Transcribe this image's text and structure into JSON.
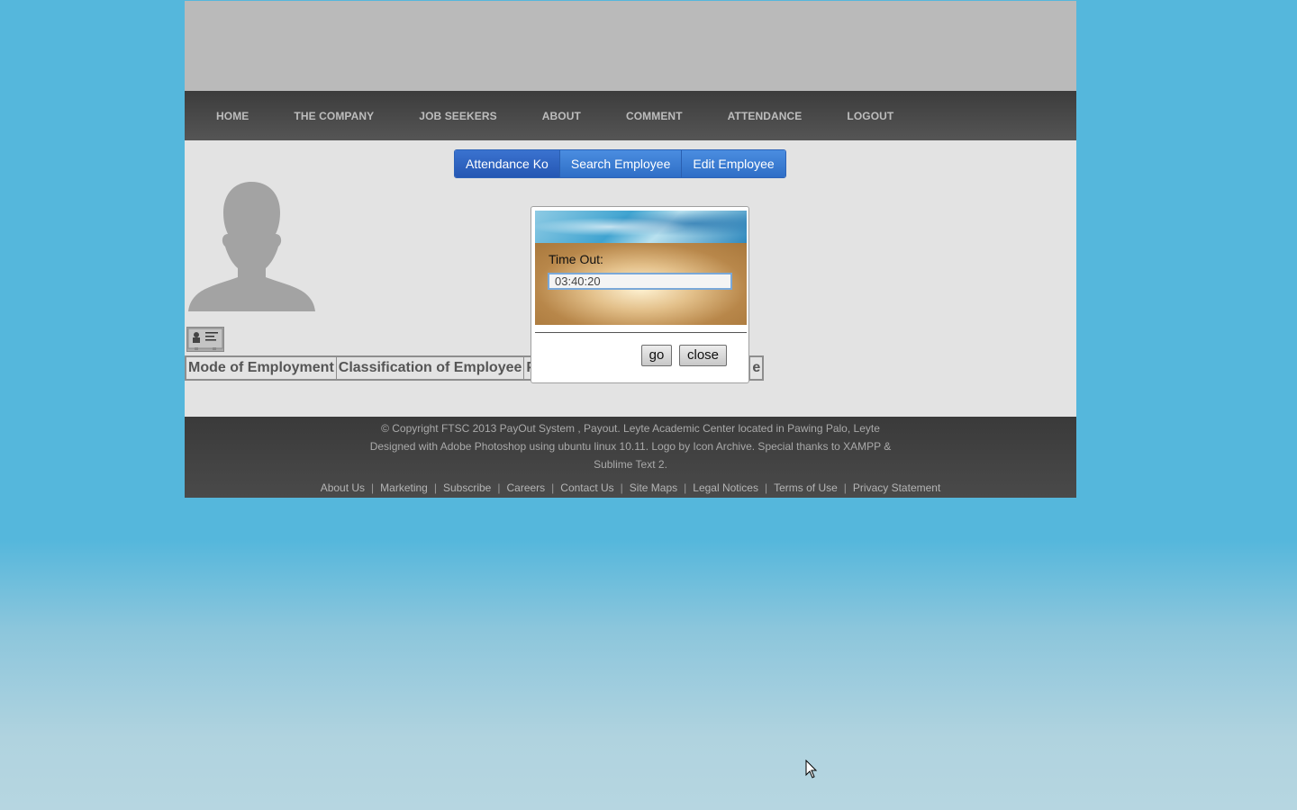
{
  "nav": {
    "items": [
      "HOME",
      "THE COMPANY",
      "JOB SEEKERS",
      "ABOUT",
      "COMMENT",
      "ATTENDANCE",
      "LOGOUT"
    ]
  },
  "subtabs": {
    "items": [
      "Attendance Ko",
      "Search Employee",
      "Edit Employee"
    ]
  },
  "table": {
    "headers": [
      "Mode of Employment",
      "Classification of Employee",
      "P",
      "e"
    ]
  },
  "modal": {
    "label": "Time Out:",
    "time_value": "03:40:20",
    "go_label": "go",
    "close_label": "close"
  },
  "footer": {
    "copyright": "© Copyright FTSC 2013 PayOut System , Payout. Leyte Academic Center located in Pawing Palo, Leyte",
    "designed_line1": "Designed with Adobe Photoshop using ubuntu linux 10.11. Logo by Icon Archive. Special thanks to XAMPP &",
    "designed_line2": "Sublime Text 2.",
    "links": [
      "About Us",
      "Marketing",
      "Subscribe",
      "Careers",
      "Contact Us",
      "Site Maps",
      "Legal Notices",
      "Terms of Use",
      "Privacy Statement"
    ]
  },
  "icons": {
    "avatar": "user-silhouette-icon",
    "card": "id-card-icon",
    "cursor": "mouse-pointer-icon"
  }
}
